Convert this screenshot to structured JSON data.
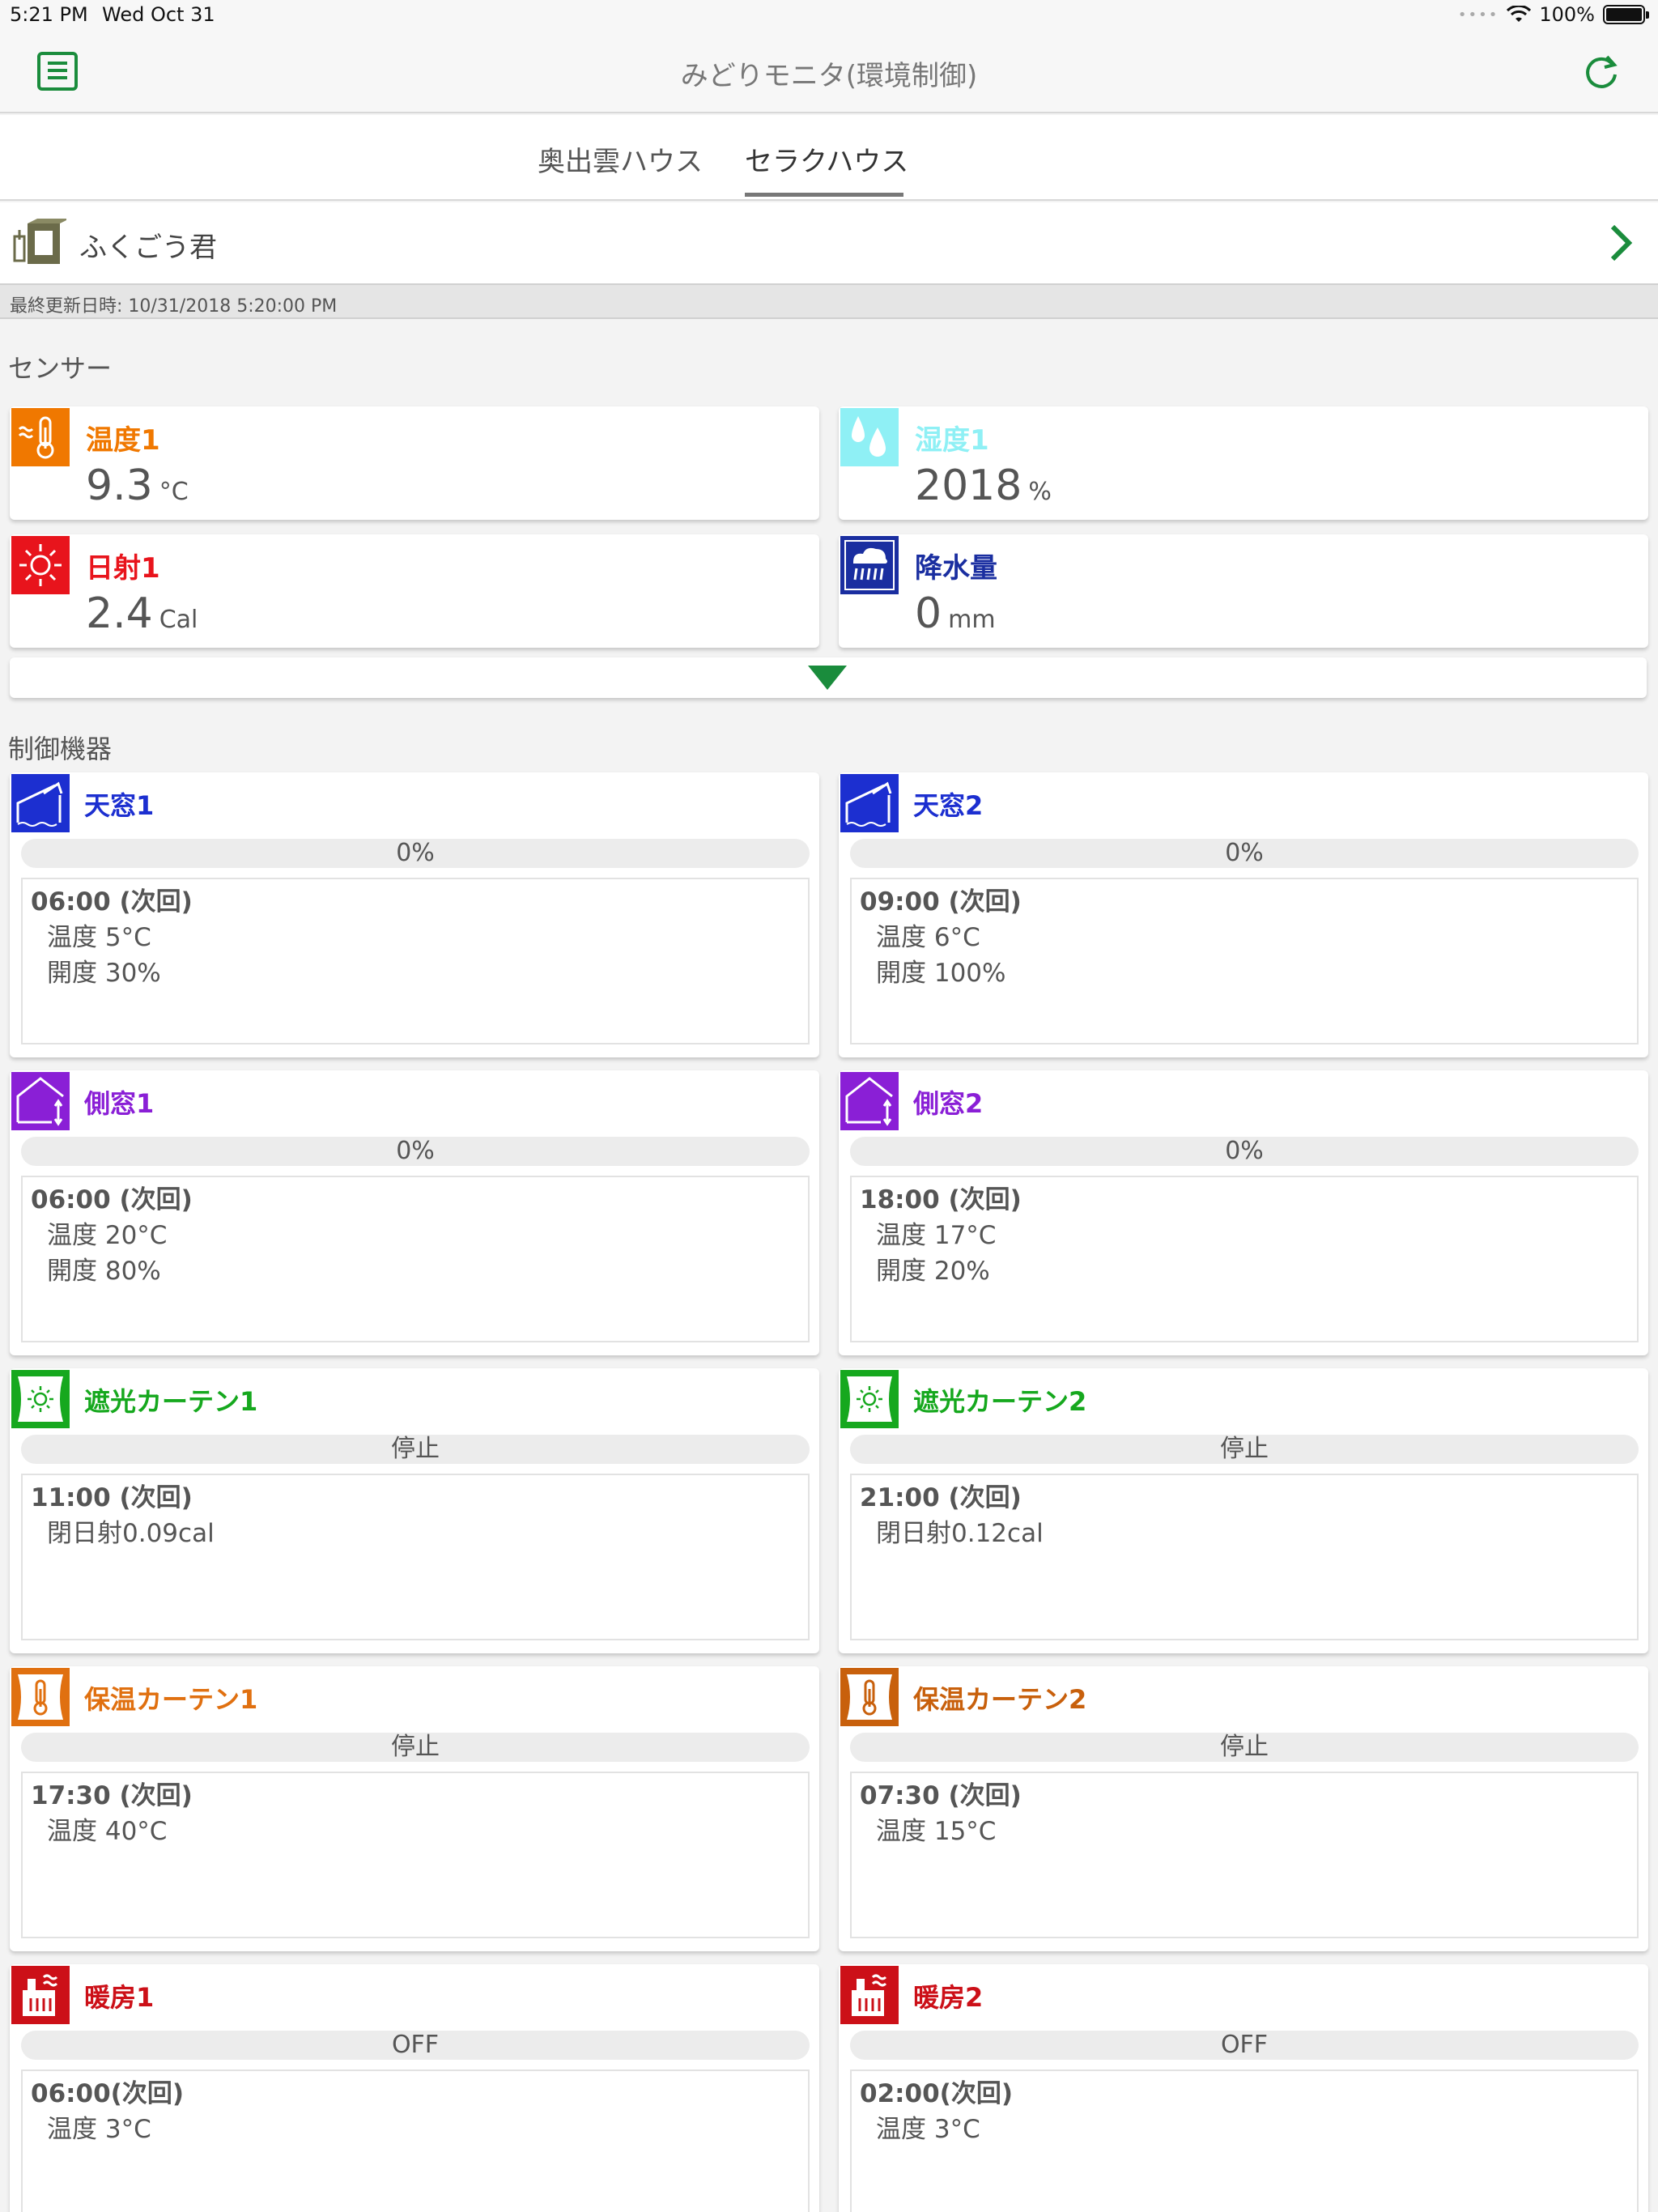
{
  "status_bar": {
    "time": "5:21 PM",
    "date": "Wed Oct 31",
    "battery": "100%"
  },
  "nav": {
    "title": "みどりモニタ(環境制御)"
  },
  "tabs": [
    {
      "label": "奥出雲ハウス"
    },
    {
      "label": "セラクハウス"
    }
  ],
  "device": {
    "name": "ふくごう君"
  },
  "updated": {
    "text": "最終更新日時: 10/31/2018 5:20:00 PM"
  },
  "sensors_section": {
    "title": "センサー"
  },
  "sensors": [
    {
      "label": "温度1",
      "value": "9.3",
      "unit": "°C",
      "color": "#f07800",
      "icon": "thermometer-icon"
    },
    {
      "label": "湿度1",
      "value": "2018",
      "unit": "%",
      "color": "#8ff0f5",
      "icon": "droplets-icon"
    },
    {
      "label": "日射1",
      "value": "2.4",
      "unit": "Cal",
      "color": "#e8141c",
      "icon": "sun-icon"
    },
    {
      "label": "降水量",
      "value": "0",
      "unit": "mm",
      "color": "#1a2ea0",
      "icon": "rain-cloud-icon"
    }
  ],
  "controls_section": {
    "title": "制御機器"
  },
  "controls": [
    {
      "label": "天窓1",
      "status": "0%",
      "color": "#1c2fd0",
      "icon": "roof-window-icon",
      "next": "06:00 (次回)",
      "details": [
        "温度 5°C",
        "開度 30%"
      ]
    },
    {
      "label": "天窓2",
      "status": "0%",
      "color": "#1c2fd0",
      "icon": "roof-window-icon",
      "next": "09:00 (次回)",
      "details": [
        "温度 6°C",
        "開度 100%"
      ]
    },
    {
      "label": "側窓1",
      "status": "0%",
      "color": "#8a1fd6",
      "icon": "side-window-icon",
      "next": "06:00 (次回)",
      "details": [
        "温度 20°C",
        "開度 80%"
      ]
    },
    {
      "label": "側窓2",
      "status": "0%",
      "color": "#8a1fd6",
      "icon": "side-window-icon",
      "next": "18:00 (次回)",
      "details": [
        "温度 17°C",
        "開度 20%"
      ]
    },
    {
      "label": "遮光カーテン1",
      "status": "停止",
      "color": "#16a81e",
      "icon": "shade-curtain-icon",
      "next": "11:00 (次回)",
      "details": [
        "閉日射0.09cal"
      ]
    },
    {
      "label": "遮光カーテン2",
      "status": "停止",
      "color": "#16a81e",
      "icon": "shade-curtain-icon",
      "next": "21:00 (次回)",
      "details": [
        "閉日射0.12cal"
      ]
    },
    {
      "label": "保温カーテン1",
      "status": "停止",
      "color": "#e07010",
      "icon": "thermal-curtain-icon",
      "next": "17:30 (次回)",
      "details": [
        "温度 40°C"
      ]
    },
    {
      "label": "保温カーテン2",
      "status": "停止",
      "color": "#c8600c",
      "icon": "thermal-curtain-icon",
      "next": "07:30 (次回)",
      "details": [
        "温度 15°C"
      ]
    },
    {
      "label": "暖房1",
      "status": "OFF",
      "color": "#cc1018",
      "icon": "heater-icon",
      "next": "06:00(次回)",
      "details": [
        "温度 3°C"
      ]
    },
    {
      "label": "暖房2",
      "status": "OFF",
      "color": "#cc1018",
      "icon": "heater-icon",
      "next": "02:00(次回)",
      "details": [
        "温度 3°C"
      ]
    }
  ],
  "colors": {
    "accent": "#1a8c3c"
  }
}
